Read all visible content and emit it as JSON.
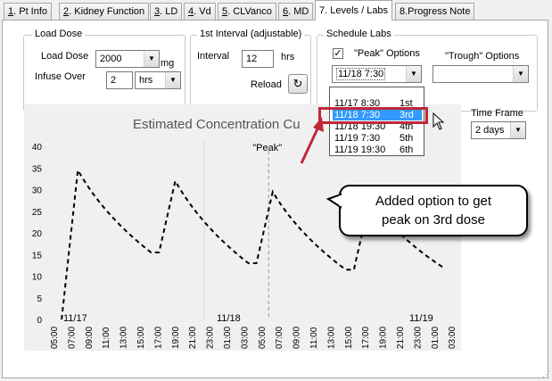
{
  "tabs": [
    {
      "num": "1",
      "label": ". Pt Info"
    },
    {
      "num": "2",
      "label": ". Kidney Function"
    },
    {
      "num": "3",
      "label": ". LD"
    },
    {
      "num": "4",
      "label": ". Vd"
    },
    {
      "num": "5",
      "label": ". CLVanco"
    },
    {
      "num": "6",
      "label": ". MD"
    },
    {
      "num": "",
      "label": "7. Levels / Labs"
    },
    {
      "num": "",
      "label": "8.Progress Note"
    }
  ],
  "load_dose": {
    "group_title": "Load Dose",
    "dose_label": "Load Dose",
    "dose_value": "2000",
    "dose_unit": "mg",
    "infuse_label": "Infuse Over",
    "infuse_value": "2",
    "infuse_unit": "hrs"
  },
  "interval": {
    "group_title": "1st Interval (adjustable)",
    "interval_label": "Interval",
    "interval_value": "12",
    "interval_unit": "hrs",
    "reload_label": "Reload",
    "reload_icon": "↻"
  },
  "schedule": {
    "group_title": "Schedule Labs",
    "peak_checked": true,
    "peak_label": "\"Peak\" Options",
    "trough_label": "\"Trough\" Options",
    "peak_selected": "11/18 7:30",
    "trough_selected": ""
  },
  "dropdown_options": [
    {
      "time": "11/17 8:30",
      "dose": "1st"
    },
    {
      "time": "11/18 7:30",
      "dose": "3rd"
    },
    {
      "time": "11/18 19:30",
      "dose": "4th"
    },
    {
      "time": "11/19 7:30",
      "dose": "5th"
    },
    {
      "time": "11/19 19:30",
      "dose": "6th"
    }
  ],
  "timeframe": {
    "label": "Time Frame",
    "value": "2 days"
  },
  "callout": {
    "line1": "Added option to get",
    "line2": "peak on 3rd dose"
  },
  "colors": {
    "highlight_border": "#c0283a",
    "selection": "#3399ff"
  },
  "chart_data": {
    "type": "line",
    "title": "Estimated Concentration Cu",
    "ylim": [
      0,
      40
    ],
    "yticks": [
      "40",
      "35",
      "30",
      "25",
      "20",
      "15",
      "10",
      "5",
      "0"
    ],
    "date_labels": [
      "11/17",
      "11/18",
      "11/19"
    ],
    "x_tick_labels": [
      "05:00",
      "07:00",
      "09:00",
      "11:00",
      "13:00",
      "15:00",
      "17:00",
      "19:00",
      "21:00",
      "23:00",
      "01:00",
      "03:00",
      "05:00",
      "07:00",
      "09:00",
      "11:00",
      "13:00",
      "15:00",
      "17:00",
      "19:00",
      "21:00",
      "23:00",
      "01:00",
      "03:00"
    ],
    "peak_marker_label": "\"Peak\"",
    "peak_marker_x": "11/18 07:30",
    "series": [
      {
        "x": [
          "11/17 06:00",
          "11/17 08:00",
          "11/17 17:00",
          "11/17 18:00",
          "11/17 20:00",
          "11/18 05:00",
          "11/18 06:00",
          "11/18 08:00",
          "11/18 17:00",
          "11/18 18:00",
          "11/18 20:00",
          "11/19 05:00"
        ],
        "values": [
          0,
          34.5,
          15.5,
          15.5,
          32,
          13,
          13,
          29.5,
          11.5,
          11.5,
          28,
          12
        ]
      }
    ]
  }
}
